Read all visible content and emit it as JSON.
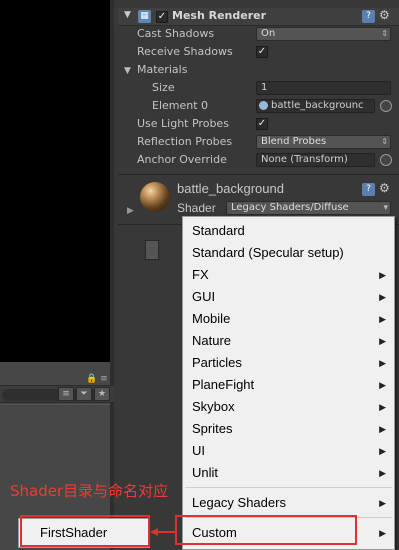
{
  "component": {
    "title": "Mesh Renderer",
    "enabled_check": "✓"
  },
  "props": {
    "cast_shadows": {
      "label": "Cast Shadows",
      "value": "On"
    },
    "receive_shadows": {
      "label": "Receive Shadows",
      "check": "✓"
    },
    "materials": {
      "label": "Materials"
    },
    "size": {
      "label": "Size",
      "value": "1"
    },
    "element0": {
      "label": "Element 0",
      "value": "battle_backgrounc"
    },
    "use_light_probes": {
      "label": "Use Light Probes",
      "check": "✓"
    },
    "reflection_probes": {
      "label": "Reflection Probes",
      "value": "Blend Probes"
    },
    "anchor_override": {
      "label": "Anchor Override",
      "value": "None (Transform)"
    }
  },
  "material": {
    "name": "battle_background",
    "shader_label": "Shader",
    "shader_value": "Legacy Shaders/Diffuse"
  },
  "shader_menu": {
    "items": [
      {
        "label": "Standard",
        "has_submenu": false
      },
      {
        "label": "Standard (Specular setup)",
        "has_submenu": false
      },
      {
        "label": "FX",
        "has_submenu": true
      },
      {
        "label": "GUI",
        "has_submenu": true
      },
      {
        "label": "Mobile",
        "has_submenu": true
      },
      {
        "label": "Nature",
        "has_submenu": true
      },
      {
        "label": "Particles",
        "has_submenu": true
      },
      {
        "label": "PlaneFight",
        "has_submenu": true
      },
      {
        "label": "Skybox",
        "has_submenu": true
      },
      {
        "label": "Sprites",
        "has_submenu": true
      },
      {
        "label": "UI",
        "has_submenu": true
      },
      {
        "label": "Unlit",
        "has_submenu": true
      },
      {
        "label": "Legacy Shaders",
        "has_submenu": true
      },
      {
        "label": "Custom",
        "has_submenu": true
      }
    ],
    "submenu_item": "FirstShader"
  },
  "annotation": {
    "text": "Shader目录与命名对应",
    "color": "#e23030"
  },
  "icons": {
    "arrow": "▶",
    "collapse": "▼",
    "help": "?",
    "settings": "⚙",
    "updown": "⇕",
    "lock": "🔒",
    "layers": "≡",
    "tag": "⏷",
    "star": "★"
  },
  "colors": {
    "menu_bg": "#f0f0f0",
    "inspector_bg": "#383838",
    "highlight_box": "#e23030"
  }
}
